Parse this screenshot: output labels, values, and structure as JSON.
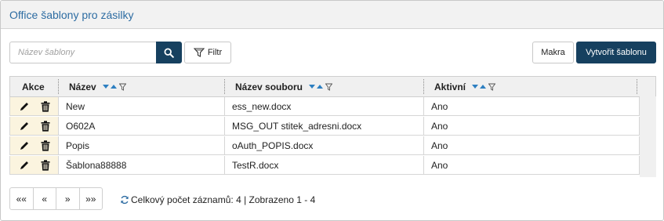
{
  "panel": {
    "title": "Office šablony pro zásilky"
  },
  "toolbar": {
    "search_placeholder": "Název šablony",
    "search_value": "",
    "filter_label": "Filtr",
    "makra_label": "Makra",
    "create_label": "Vytvořit šablonu"
  },
  "table": {
    "columns": [
      "Akce",
      "Název",
      "Název souboru",
      "Aktivní"
    ],
    "rows": [
      {
        "name": "New",
        "file": "ess_new.docx",
        "active": "Ano"
      },
      {
        "name": "O602A",
        "file": "MSG_OUT stitek_adresni.docx",
        "active": "Ano"
      },
      {
        "name": "Popis",
        "file": "oAuth_POPIS.docx",
        "active": "Ano"
      },
      {
        "name": "Šablona88888",
        "file": "TestR.docx",
        "active": "Ano"
      }
    ]
  },
  "pager": {
    "first": "««",
    "prev": "«",
    "next": "»",
    "last": "»»",
    "status": "Celkový počet záznamů: 4 | Zobrazeno 1 - 4"
  },
  "colors": {
    "primary": "#16405f",
    "title": "#2d6ca2",
    "action_bg": "#fbf4df",
    "sort_arrow": "#2d7fc1"
  },
  "icons": [
    "search-icon",
    "filter-icon",
    "edit-icon",
    "trash-icon",
    "refresh-icon",
    "sort-icon"
  ]
}
